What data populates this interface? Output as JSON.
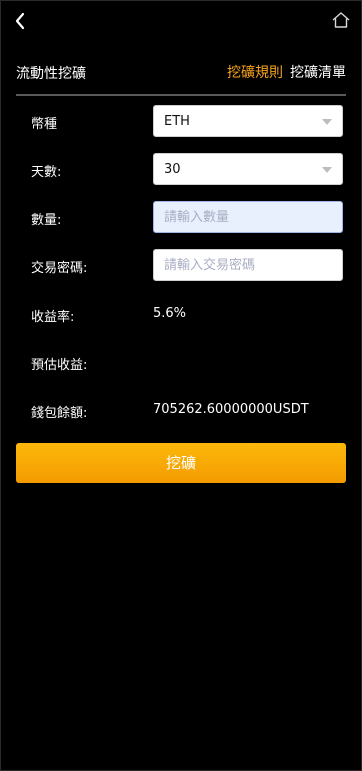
{
  "header": {
    "back_icon": "chevron-left-icon",
    "home_icon": "home-outline-icon"
  },
  "subheader": {
    "title": "流動性挖礦",
    "rules_link": "挖礦規則",
    "list_link": "挖礦清單",
    "rules_color": "#f7a41c"
  },
  "form": {
    "currency": {
      "label": "幣種",
      "value": "ETH"
    },
    "days": {
      "label": "天數:",
      "value": "30"
    },
    "quantity": {
      "label": "數量:",
      "placeholder": "請輸入數量"
    },
    "trade_password": {
      "label": "交易密碼:",
      "placeholder": "請輸入交易密碼"
    },
    "yield_rate": {
      "label": "收益率:",
      "value": "5.6%"
    },
    "estimated_income": {
      "label": "預估收益:",
      "value": ""
    },
    "wallet_balance": {
      "label": "錢包餘額:",
      "value": "705262.60000000USDT"
    }
  },
  "actions": {
    "mine_label": "挖礦",
    "mine_color": "#f7a41c"
  }
}
